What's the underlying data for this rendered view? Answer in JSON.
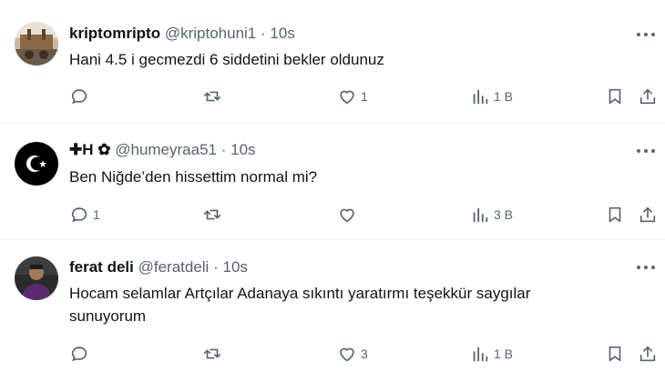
{
  "tweets": [
    {
      "name": "kriptomripto",
      "handle": "@kriptohuni1",
      "separator": "·",
      "time": "10s",
      "text": "Hani 4.5 i gecmezdi 6 siddetini bekler oldunuz",
      "reply_count": "",
      "repost_count": "",
      "like_count": "1",
      "view_count": "1 B",
      "avatar": "photo-avatar"
    },
    {
      "name": "✚H ✿",
      "handle": "@humeyraa51",
      "separator": "·",
      "time": "10s",
      "text": "Ben Niğde’den hissettim normal mi?",
      "reply_count": "1",
      "repost_count": "",
      "like_count": "",
      "view_count": "3 B",
      "avatar": "crescent-star-avatar"
    },
    {
      "name": "ferat deli",
      "handle": "@feratdeli",
      "separator": "·",
      "time": "10s",
      "text": "Hocam selamlar Artçılar Adanaya sıkıntı yaratırmı teşekkür saygılar sunuyorum",
      "reply_count": "",
      "repost_count": "",
      "like_count": "3",
      "view_count": "1 B",
      "avatar": "person-avatar"
    }
  ],
  "icons": [
    "more-icon",
    "reply-icon",
    "repost-icon",
    "like-icon",
    "views-icon",
    "bookmark-icon",
    "share-icon"
  ],
  "colors": {
    "text": "#0f1419",
    "secondary": "#536471",
    "divider": "#eff3f4"
  }
}
